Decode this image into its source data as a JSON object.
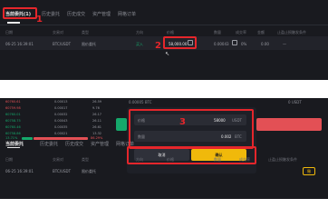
{
  "top": {
    "tabs": [
      "当前委托(1)",
      "历史委托",
      "历史成交",
      "资产管理",
      "网格订单"
    ],
    "columns": [
      "日期",
      "交易对",
      "类型",
      "方向",
      "价格",
      "数量",
      "成交率",
      "金额",
      "止盈止损触发条件"
    ],
    "row": {
      "date": "06-25 16:39:01",
      "pair": "BTC/USDT",
      "type": "限价委托",
      "side": "买入",
      "price": "58,000.00",
      "qty": "0.00043",
      "rate": "0%",
      "amount": "0.00",
      "trigger": "—"
    }
  },
  "orderbook": {
    "rows": [
      {
        "price": "60760.61",
        "qty": "0.00013",
        "total": "26.59"
      },
      {
        "price": "60759.98",
        "qty": "0.00017",
        "total": "9.76"
      },
      {
        "price": "60760.01",
        "qty": "0.00032",
        "total": "26.17"
      },
      {
        "price": "60758.75",
        "qty": "0.00043",
        "total": "26.11"
      },
      {
        "price": "60760.46",
        "qty": "0.00035",
        "total": "26.61"
      },
      {
        "price": "60758.86",
        "qty": "0.00021",
        "total": "13.32"
      }
    ],
    "ratio_buy": "13.71%",
    "ratio_sell": "86.29%"
  },
  "middle": {
    "available_btc": "0.00005 BTC",
    "available_usdt": "0 USDT"
  },
  "dialog": {
    "price_label": "价格",
    "price_value": "58000",
    "price_unit": "USDT",
    "qty_label": "数量",
    "qty_value": "0.002",
    "qty_unit": "BTC",
    "cancel": "取消",
    "confirm": "确认"
  },
  "bottom": {
    "tabs": [
      "当前委托",
      "历史委托",
      "历史成交",
      "资产管理",
      "网格订单"
    ],
    "columns": [
      "日期",
      "交易对",
      "类型",
      "方向",
      "价格",
      "数量",
      "成交率",
      "止盈止损触发条件"
    ],
    "row": {
      "date": "06-25 16:39:01",
      "pair": "BTC/USDT",
      "type": "限价委托"
    },
    "close_btn": "撤"
  },
  "steps": [
    "1",
    "2",
    "3"
  ],
  "colors": {
    "annotation": "#e5262b",
    "confirm": "#f0b90b",
    "buy": "#15a86b",
    "sell": "#e35055",
    "panel": "#191a1f"
  }
}
